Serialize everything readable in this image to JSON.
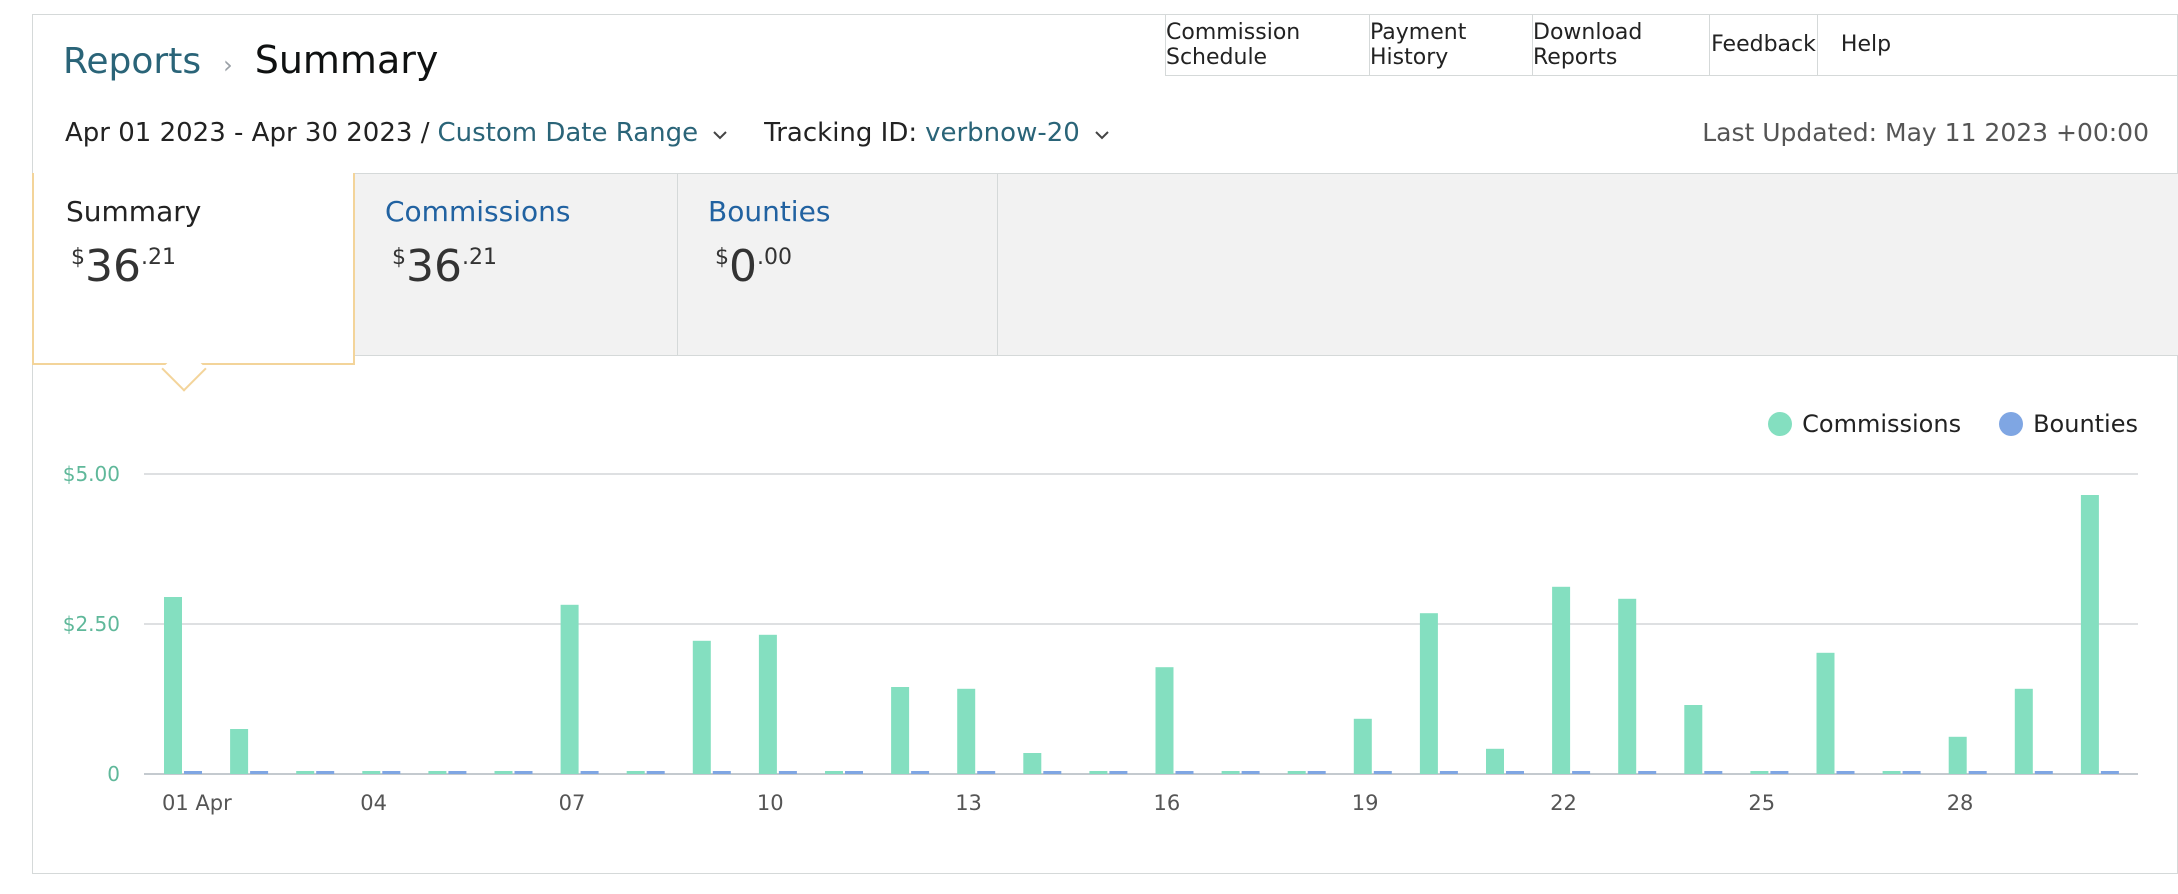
{
  "breadcrumb": {
    "root": "Reports",
    "current": "Summary"
  },
  "top_tabs": [
    "Commission Schedule",
    "Payment History",
    "Download Reports",
    "Feedback",
    "Help"
  ],
  "filters": {
    "date_range": "Apr 01 2023 - Apr 30 2023 /",
    "range_type": "Custom Date Range",
    "tracking_label": "Tracking ID:",
    "tracking_id": "verbnow-20"
  },
  "last_updated": "Last Updated: May 11 2023 +00:00",
  "tiles": {
    "summary": {
      "label": "Summary",
      "currency": "$",
      "whole": "36",
      "frac": ".21"
    },
    "commissions": {
      "label": "Commissions",
      "currency": "$",
      "whole": "36",
      "frac": ".21"
    },
    "bounties": {
      "label": "Bounties",
      "currency": "$",
      "whole": "0",
      "frac": ".00"
    }
  },
  "legend": {
    "commissions": "Commissions",
    "bounties": "Bounties"
  },
  "colors": {
    "commissions": "#84dfc0",
    "bounties": "#7fa6e3",
    "accent_link": "#2a6478"
  },
  "chart_data": {
    "type": "bar",
    "categories": [
      "01 Apr",
      "02",
      "03",
      "04",
      "05",
      "06",
      "07",
      "08",
      "09",
      "10",
      "11",
      "12",
      "13",
      "14",
      "15",
      "16",
      "17",
      "18",
      "19",
      "20",
      "21",
      "22",
      "23",
      "24",
      "25",
      "26",
      "27",
      "28",
      "29",
      "30"
    ],
    "tick_labels": [
      {
        "index": 0,
        "label": "01 Apr"
      },
      {
        "index": 3,
        "label": "04"
      },
      {
        "index": 6,
        "label": "07"
      },
      {
        "index": 9,
        "label": "10"
      },
      {
        "index": 12,
        "label": "13"
      },
      {
        "index": 15,
        "label": "16"
      },
      {
        "index": 18,
        "label": "19"
      },
      {
        "index": 21,
        "label": "22"
      },
      {
        "index": 24,
        "label": "25"
      },
      {
        "index": 27,
        "label": "28"
      }
    ],
    "yticks": [
      {
        "value": 0,
        "label": "0"
      },
      {
        "value": 2.5,
        "label": "$2.50"
      },
      {
        "value": 5,
        "label": "$5.00"
      }
    ],
    "ylim": [
      0,
      5
    ],
    "series": [
      {
        "name": "Commissions",
        "values": [
          2.95,
          0.75,
          0.05,
          0.05,
          0.05,
          0.05,
          2.82,
          0.05,
          2.22,
          2.32,
          0.05,
          1.45,
          1.42,
          0.35,
          0.05,
          1.78,
          0.05,
          0.05,
          0.92,
          2.68,
          0.42,
          3.12,
          2.92,
          1.15,
          0.05,
          2.02,
          0.05,
          0.62,
          1.42,
          4.65
        ]
      },
      {
        "name": "Bounties",
        "values": [
          0.05,
          0.05,
          0.05,
          0.05,
          0.05,
          0.05,
          0.05,
          0.05,
          0.05,
          0.05,
          0.05,
          0.05,
          0.05,
          0.05,
          0.05,
          0.05,
          0.05,
          0.05,
          0.05,
          0.05,
          0.05,
          0.05,
          0.05,
          0.05,
          0.05,
          0.05,
          0.05,
          0.05,
          0.05,
          0.05
        ]
      }
    ],
    "grid": true,
    "legend_position": "top-right"
  }
}
